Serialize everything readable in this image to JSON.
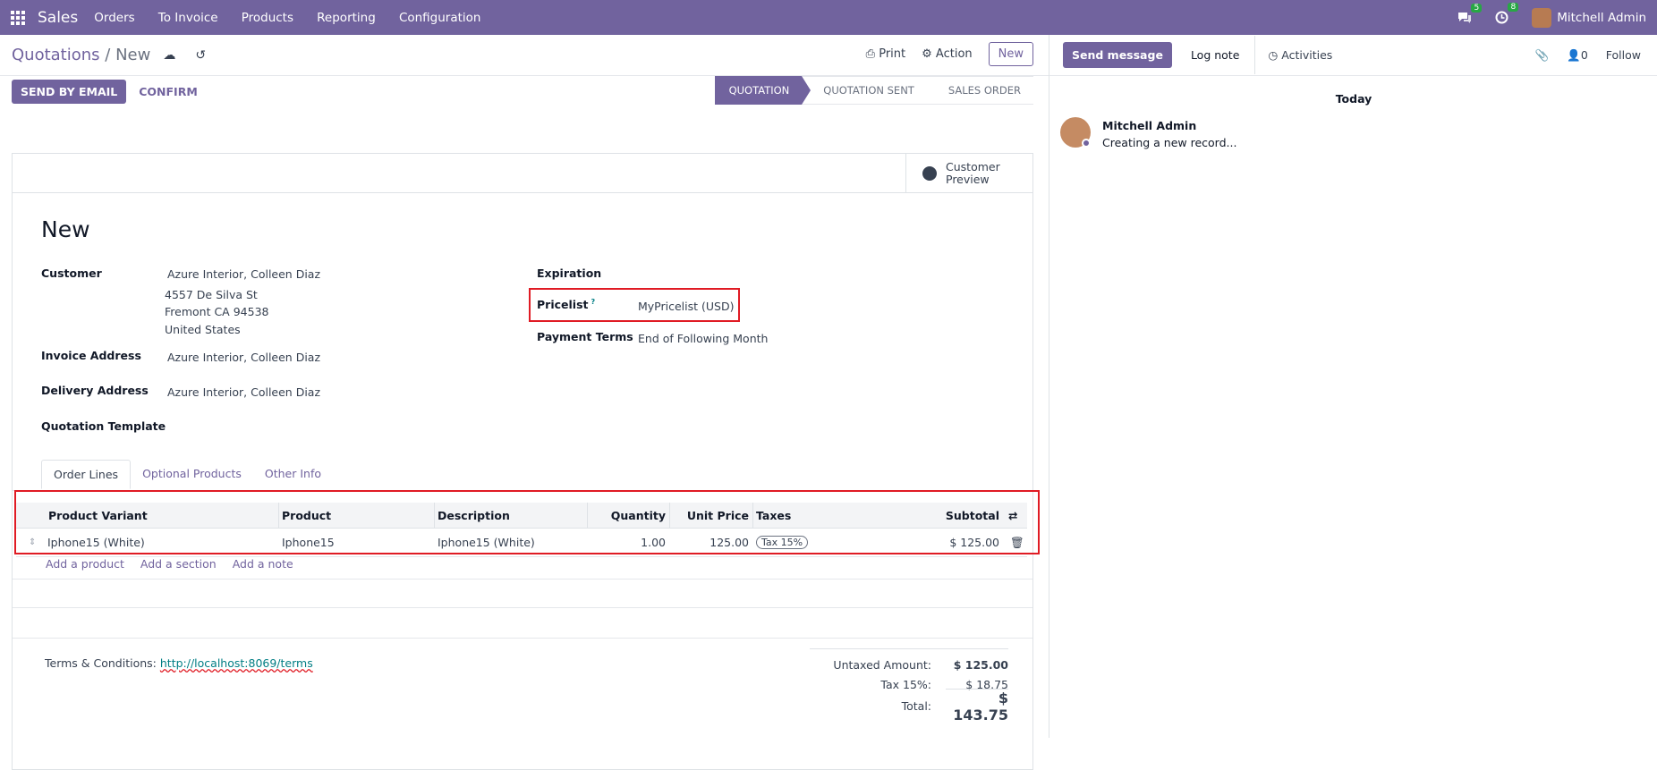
{
  "topbar": {
    "app_name": "Sales",
    "menu": [
      "Orders",
      "To Invoice",
      "Products",
      "Reporting",
      "Configuration"
    ],
    "messages_count": "5",
    "activities_count": "8",
    "user_name": "Mitchell Admin"
  },
  "control": {
    "breadcrumb_parent": "Quotations",
    "breadcrumb_sep": "/",
    "breadcrumb_current": "New",
    "print_label": "Print",
    "action_label": "Action",
    "new_label": "New"
  },
  "statusbar": {
    "send_email_label": "SEND BY EMAIL",
    "confirm_label": "CONFIRM",
    "stages": [
      "QUOTATION",
      "QUOTATION SENT",
      "SALES ORDER"
    ]
  },
  "sheet": {
    "customer_preview_label": "Customer Preview",
    "title": "New",
    "customer_label": "Customer",
    "customer_name": "Azure Interior, Colleen Diaz",
    "customer_addr1": "4557 De Silva St",
    "customer_addr2": "Fremont CA 94538",
    "customer_addr3": "United States",
    "invoice_label": "Invoice Address",
    "invoice_value": "Azure Interior, Colleen Diaz",
    "delivery_label": "Delivery Address",
    "delivery_value": "Azure Interior, Colleen Diaz",
    "template_label": "Quotation Template",
    "expiration_label": "Expiration",
    "pricelist_label": "Pricelist",
    "pricelist_help": "?",
    "pricelist_value": "MyPricelist (USD)",
    "payment_terms_label": "Payment Terms",
    "payment_terms_value": "End of Following Month"
  },
  "tabs": [
    "Order Lines",
    "Optional Products",
    "Other Info"
  ],
  "order_lines": {
    "headers": [
      "Product Variant",
      "Product",
      "Description",
      "Quantity",
      "Unit Price",
      "Taxes",
      "Subtotal"
    ],
    "rows": [
      {
        "variant": "Iphone15 (White)",
        "product": "Iphone15",
        "description": "Iphone15 (White)",
        "quantity": "1.00",
        "unit_price": "125.00",
        "taxes": "Tax 15%",
        "subtotal": "$ 125.00"
      }
    ],
    "add_product": "Add a product",
    "add_section": "Add a section",
    "add_note": "Add a note"
  },
  "footer": {
    "terms_label": "Terms & Conditions:",
    "terms_link": "http://localhost:8069/terms",
    "untaxed_label": "Untaxed Amount:",
    "untaxed_value": "$ 125.00",
    "tax_label": "Tax 15%:",
    "tax_value": "$ 18.75",
    "total_label": "Total:",
    "total_value": "$ 143.75"
  },
  "chatter": {
    "send_message_label": "Send message",
    "log_note_label": "Log note",
    "activities_label": "Activities",
    "followers_count": "0",
    "follow_label": "Follow",
    "date_separator": "Today",
    "message_author": "Mitchell Admin",
    "message_body": "Creating a new record..."
  },
  "colors": {
    "brand": "#71639e",
    "highlight": "#e01b24",
    "link": "#017e84"
  }
}
